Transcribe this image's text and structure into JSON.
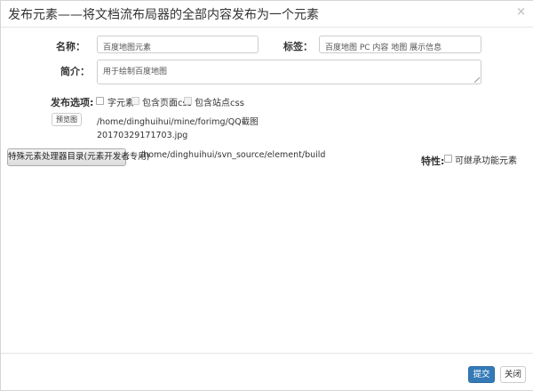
{
  "dialog": {
    "title": "发布元素——将文档流布局器的全部内容发布为一个元素",
    "close_symbol": "×"
  },
  "form": {
    "name_label": "名称：",
    "name_value": "百度地图元素",
    "tags_label": "标签：",
    "tags_value": "百度地图 PC 内容 地图 展示信息",
    "intro_label": "简介：",
    "intro_value": "用于绘制百度地图",
    "publish_options_label": "发布选项:",
    "options": [
      {
        "label": "字元素",
        "checked": false,
        "disabled": false
      },
      {
        "label": "包含页面css",
        "checked": false,
        "disabled": true
      },
      {
        "label": "包含站点css",
        "checked": false,
        "disabled": true
      }
    ],
    "preview_button": "预览图",
    "preview_path_line1": "/home/dinghuihui/mine/forimg/QQ截图",
    "preview_path_line2": "20170329171703.jpg",
    "processor_dir_button": "特殊元素处理器目录(元素开发者专用)",
    "processor_dir_suffix": ":",
    "processor_dir_path": "/home/dinghuihui/svn_source/element/build",
    "feature_label": "特性:",
    "feature_option": {
      "label": "可继承功能元素",
      "checked": false
    }
  },
  "footer": {
    "submit_label": "提交",
    "close_label": "关闭"
  },
  "colors": {
    "primary": "#337ab7",
    "border": "#cccccc"
  }
}
